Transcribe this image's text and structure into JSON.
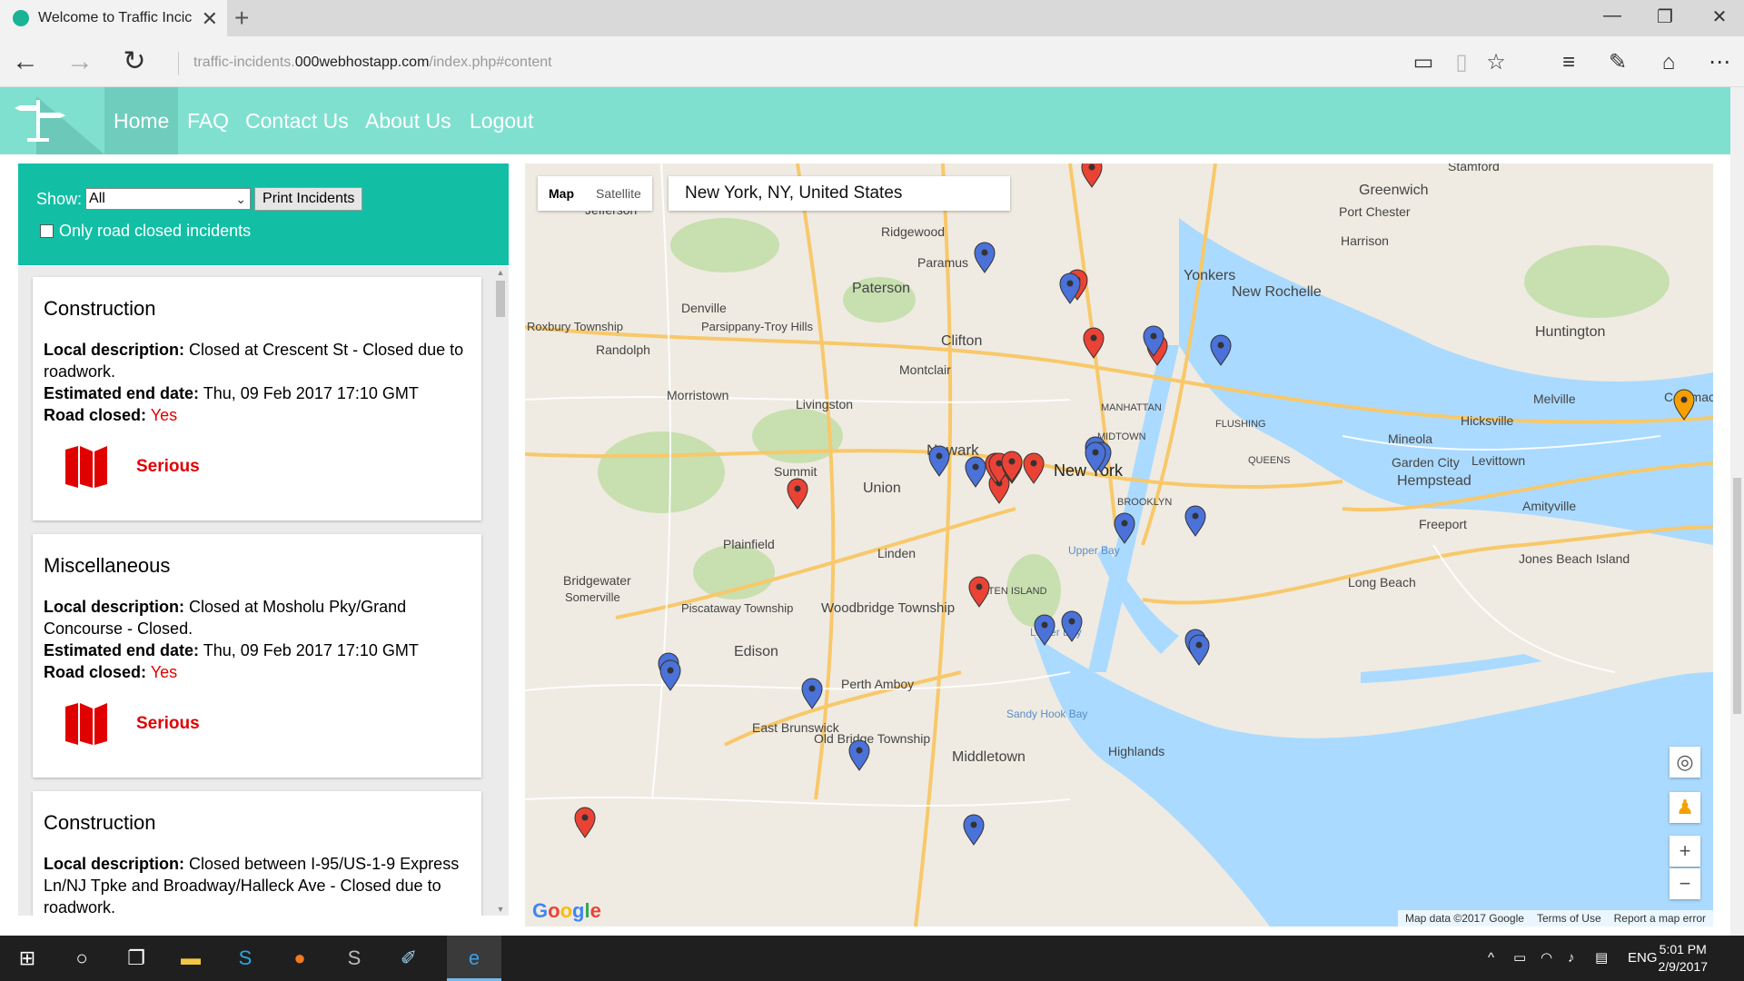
{
  "browser": {
    "tab_title": "Welcome to Traffic Incic",
    "url_prefix": "traffic-incidents.",
    "url_domain": "000webhostapp.com",
    "url_path": "/index.php#content"
  },
  "site": {
    "nav": [
      "Home",
      "FAQ",
      "Contact Us",
      "About Us",
      "Logout"
    ],
    "active_nav": "Home",
    "accent": "#80e0d0"
  },
  "filter": {
    "show_label": "Show:",
    "show_value": "All",
    "print_button": "Print Incidents",
    "road_closed_label": "Only road closed incidents"
  },
  "incidents": [
    {
      "title": "Construction",
      "desc_label": "Local description:",
      "desc": "Closed at Crescent St - Closed due to roadwork.",
      "end_label": "Estimated end date:",
      "end": "Thu, 09 Feb 2017 17:10 GMT",
      "closed_label": "Road closed:",
      "closed": "Yes",
      "severity": "Serious"
    },
    {
      "title": "Miscellaneous",
      "desc_label": "Local description:",
      "desc": "Closed at Mosholu Pky/Grand Concourse - Closed.",
      "end_label": "Estimated end date:",
      "end": "Thu, 09 Feb 2017 17:10 GMT",
      "closed_label": "Road closed:",
      "closed": "Yes",
      "severity": "Serious"
    },
    {
      "title": "Construction",
      "desc_label": "Local description:",
      "desc": "Closed between I-95/US-1-9 Express Ln/NJ Tpke and Broadway/Halleck Ave - Closed due to roadwork."
    }
  ],
  "map": {
    "type_map": "Map",
    "type_satellite": "Satellite",
    "search_value": "New York, NY, United States",
    "footer": [
      "Map data ©2017 Google",
      "Terms of Use",
      "Report a map error"
    ],
    "logo": "Google",
    "places": [
      "Jefferson",
      "Ridgewood",
      "Paramus",
      "Paterson",
      "Yonkers",
      "New Rochelle",
      "Greenwich",
      "Port Chester",
      "Harrison",
      "Stamford",
      "Huntington",
      "Denville",
      "Roxbury Township",
      "Parsippany-Troy Hills",
      "Randolph",
      "Clifton",
      "Montclair",
      "Morristown",
      "Livingston",
      "Newark",
      "New York",
      "MANHATTAN",
      "MIDTOWN",
      "FLUSHING",
      "QUEENS",
      "BROOKLYN",
      "Melville",
      "Hicksville",
      "Mineola",
      "Garden City",
      "Levittown",
      "Hempstead",
      "Amityville",
      "Freeport",
      "Jones Beach Island",
      "Long Beach",
      "Summit",
      "Union",
      "Linden",
      "Plainfield",
      "Bridgewater",
      "Somerville",
      "Piscataway Township",
      "Edison",
      "Woodbridge Township",
      "Perth Amboy",
      "STATEN ISLAND",
      "East Brunswick",
      "Old Bridge Township",
      "Middletown",
      "Highlands",
      "Sandy Hook Bay",
      "Lower Bay",
      "Upper Bay",
      "Commack"
    ],
    "markers": {
      "red": 13,
      "blue": 20,
      "orange": 1
    },
    "marker_colors": {
      "red": "#ea4335",
      "blue": "#4a72d8",
      "orange": "#f5a000"
    }
  },
  "taskbar": {
    "language": "ENG",
    "time": "5:01 PM",
    "date": "2/9/2017"
  }
}
